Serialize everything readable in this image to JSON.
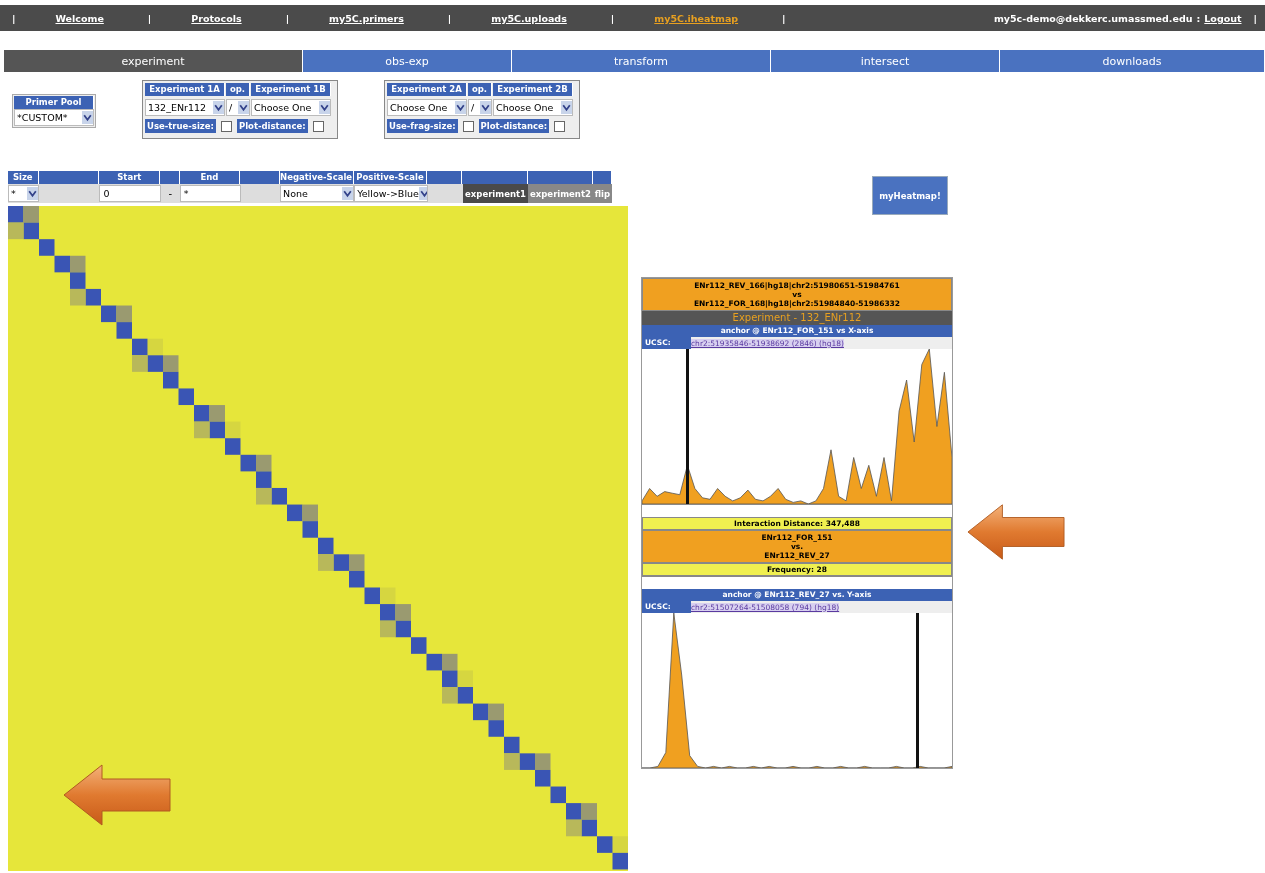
{
  "nav": [
    {
      "kind": "sep",
      "label": "|"
    },
    {
      "kind": "link",
      "label": "Welcome",
      "selected": false
    },
    {
      "kind": "sep",
      "label": "|"
    },
    {
      "kind": "link",
      "label": "Protocols",
      "selected": false
    },
    {
      "kind": "sep",
      "label": "|"
    },
    {
      "kind": "link",
      "label": "my5C.primers",
      "selected": false
    },
    {
      "kind": "sep",
      "label": "|"
    },
    {
      "kind": "link",
      "label": "my5C.uploads",
      "selected": false
    },
    {
      "kind": "sep",
      "label": "|"
    },
    {
      "kind": "link",
      "label": "my5C.iheatmap",
      "selected": true
    },
    {
      "kind": "sep",
      "label": "|"
    }
  ],
  "user": {
    "email": "my5c-demo@dekkerc.umassmed.edu",
    "separator": ":",
    "logout": "Logout",
    "end": "|"
  },
  "tabs": [
    {
      "label": "experiment",
      "selected": true
    },
    {
      "label": "obs-exp",
      "selected": false
    },
    {
      "label": "transform",
      "selected": false
    },
    {
      "label": "intersect",
      "selected": false
    },
    {
      "label": "downloads",
      "selected": false
    }
  ],
  "primer_pool": {
    "header": "Primer Pool",
    "value": "*CUSTOM*"
  },
  "experiment_groups": [
    {
      "headers": [
        "Experiment 1A",
        "op.",
        "Experiment 1B"
      ],
      "selects": [
        "132_ENr112",
        "/",
        "Choose One"
      ],
      "options": [
        {
          "label": "Use-true-size:",
          "checked": false
        },
        {
          "label": "Plot-distance:",
          "checked": false
        }
      ]
    },
    {
      "headers": [
        "Experiment 2A",
        "op.",
        "Experiment 2B"
      ],
      "selects": [
        "Choose One",
        "/",
        "Choose One"
      ],
      "options": [
        {
          "label": "Use-frag-size:",
          "checked": false
        },
        {
          "label": "Plot-distance:",
          "checked": false
        }
      ]
    }
  ],
  "controls": {
    "size": {
      "header": "Size",
      "value": "*"
    },
    "start": {
      "header": "Start",
      "value": "0"
    },
    "dash": "-",
    "end": {
      "header": "End",
      "value": "*"
    },
    "negative_scale": {
      "header": "Negative-Scale",
      "value": "None"
    },
    "positive_scale": {
      "header": "Positive-Scale",
      "value": "Yellow->Blue"
    },
    "buttons": [
      {
        "label": "experiment1",
        "selected": true
      },
      {
        "label": "experiment2",
        "selected": false
      },
      {
        "label": "flip",
        "selected": false
      }
    ]
  },
  "heatmap_button": "myHeatmap!",
  "detail": {
    "pair_header": [
      "ENr112_REV_166|hg18|chr2:51980651-51984761",
      "vs",
      "ENr112_FOR_168|hg18|chr2:51984840-51986332"
    ],
    "experiment_title": "Experiment - 132_ENr112",
    "x_anchor": {
      "title": "anchor @ ENr112_FOR_151 vs X-axis",
      "ucsc_label": "UCSC:",
      "link": "chr2:51935846-51938692 (2846) (hg18)"
    },
    "interaction": {
      "distance": "Interaction Distance: 347,488",
      "pair": [
        "ENr112_FOR_151",
        "vs.",
        "ENr112_REV_27"
      ],
      "frequency": "Frequency: 28"
    },
    "y_anchor": {
      "title": "anchor @ ENr112_REV_27 vs. Y-axis",
      "ucsc_label": "UCSC:",
      "link": "chr2:51507264-51508058 (794) (hg18)"
    }
  }
}
